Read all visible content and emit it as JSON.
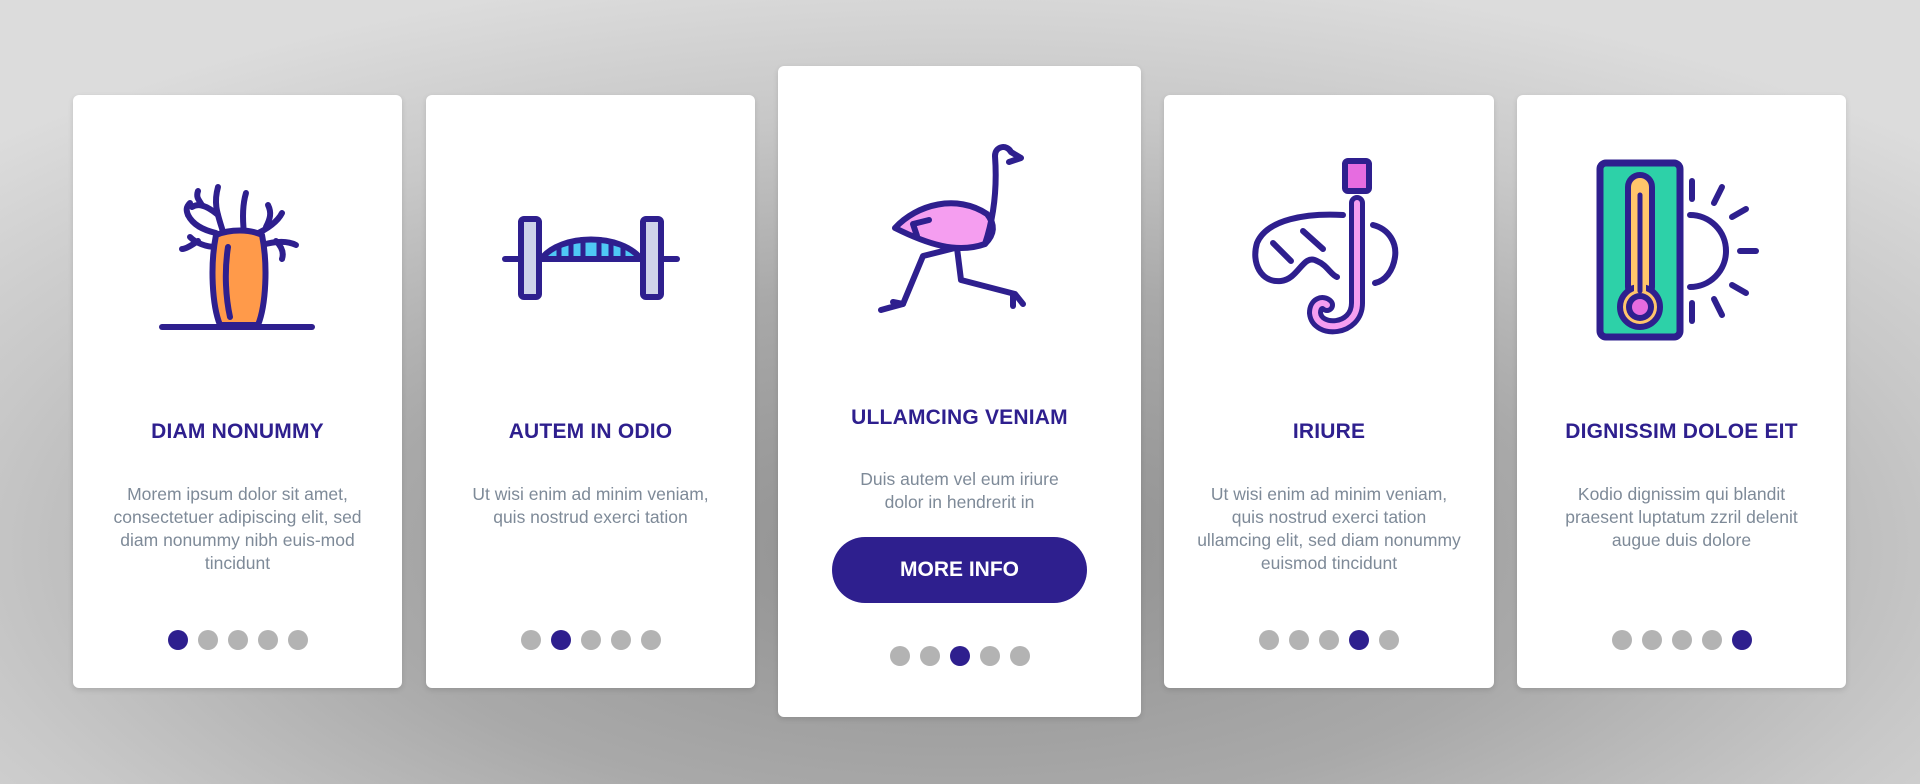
{
  "colors": {
    "primary": "#2e1f8e",
    "dot_inactive": "#b3b3b3",
    "body_text": "#7e8a98",
    "orange": "#ff9a4a",
    "pink": "#f59ef0",
    "magenta": "#e66ce0",
    "sky": "#4fc8f5",
    "pale_blue": "#cfd3ea",
    "teal": "#2dd1a8",
    "amber": "#ffc56b"
  },
  "cards": [
    {
      "title": "DIAM NONUMMY",
      "body": "Morem ipsum dolor sit amet, consectetuer adipiscing elit, sed diam nonummy nibh euis-mod tincidunt",
      "icon": "baobab-tree-icon",
      "active_page": 1,
      "total_pages": 5
    },
    {
      "title": "AUTEM IN ODIO",
      "body": "Ut wisi enim ad minim veniam, quis nostrud exerci tation",
      "icon": "arch-bridge-icon",
      "active_page": 2,
      "total_pages": 5
    },
    {
      "title": "ULLAMCING VENIAM",
      "body": "Duis autem vel eum iriure dolor in hendrerit in",
      "icon": "ostrich-icon",
      "button_label": "MORE INFO",
      "active_page": 3,
      "total_pages": 5
    },
    {
      "title": "IRIURE",
      "body": "Ut wisi enim ad minim veniam, quis nostrud exerci tation ullamcing elit, sed diam nonummy euismod tincidunt",
      "icon": "snorkel-mask-icon",
      "active_page": 4,
      "total_pages": 5
    },
    {
      "title": "DIGNISSIM DOLOE EIT",
      "body": "Kodio dignissim qui blandit praesent luptatum zzril delenit augue duis dolore",
      "icon": "thermometer-sun-icon",
      "active_page": 5,
      "total_pages": 5
    }
  ]
}
